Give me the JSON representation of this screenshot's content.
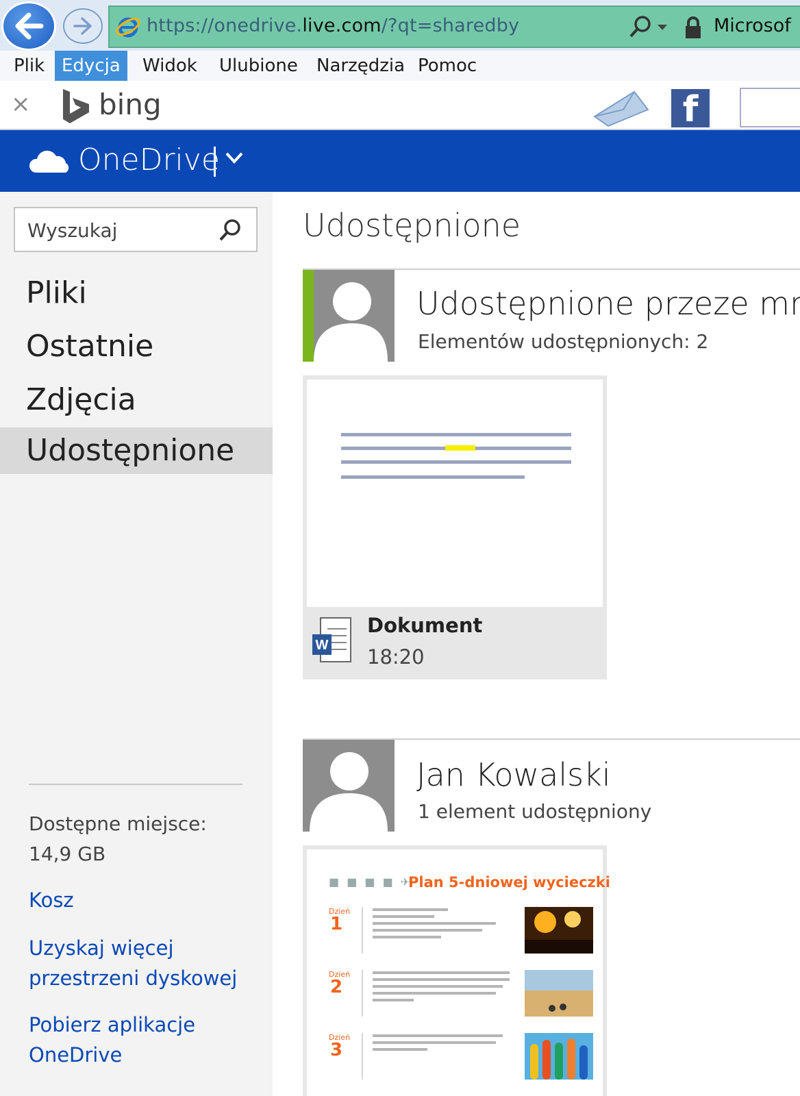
{
  "browser": {
    "url_prefix": "https://onedrive.",
    "url_domain": "live.com",
    "url_suffix": "/?qt=sharedby",
    "site_label": "Microsof",
    "menu": [
      "Plik",
      "Edycja",
      "Widok",
      "Ulubione",
      "Narzędzia",
      "Pomoc"
    ],
    "active_menu": "Edycja",
    "toolbar": {
      "close": "×",
      "search_brand": "bing"
    }
  },
  "onedrive": {
    "app_title": "OneDrive",
    "brand_color": "#0a48b5"
  },
  "sidebar": {
    "search_placeholder": "Wyszukaj",
    "nav": [
      "Pliki",
      "Ostatnie",
      "Zdjęcia",
      "Udostępnione"
    ],
    "active_nav": "Udostępnione",
    "space_label": "Dostępne miejsce:",
    "space_value": "14,9 GB",
    "links": {
      "trash": "Kosz",
      "more_storage_line1": "Uzyskaj więcej",
      "more_storage_line2": "przestrzeni dyskowej",
      "get_apps_line1": "Pobierz aplikacje",
      "get_apps_line2": "OneDrive"
    }
  },
  "main": {
    "title": "Udostępnione",
    "sections": [
      {
        "title": "Udostępnione przeze mnie",
        "subtitle": "Elementów udostępnionych: 2",
        "accent": "#7ab51d",
        "items": [
          {
            "name": "Dokument",
            "time": "18:20",
            "type": "word"
          }
        ]
      },
      {
        "title": "Jan Kowalski",
        "subtitle": "1 element udostępniony",
        "items": [
          {
            "preview_title": "Plan 5-dniowej wycieczki",
            "days": [
              {
                "label": "Dzień",
                "number": "1"
              },
              {
                "label": "Dzień",
                "number": "2"
              },
              {
                "label": "Dzień",
                "number": "3"
              }
            ]
          }
        ]
      }
    ]
  }
}
